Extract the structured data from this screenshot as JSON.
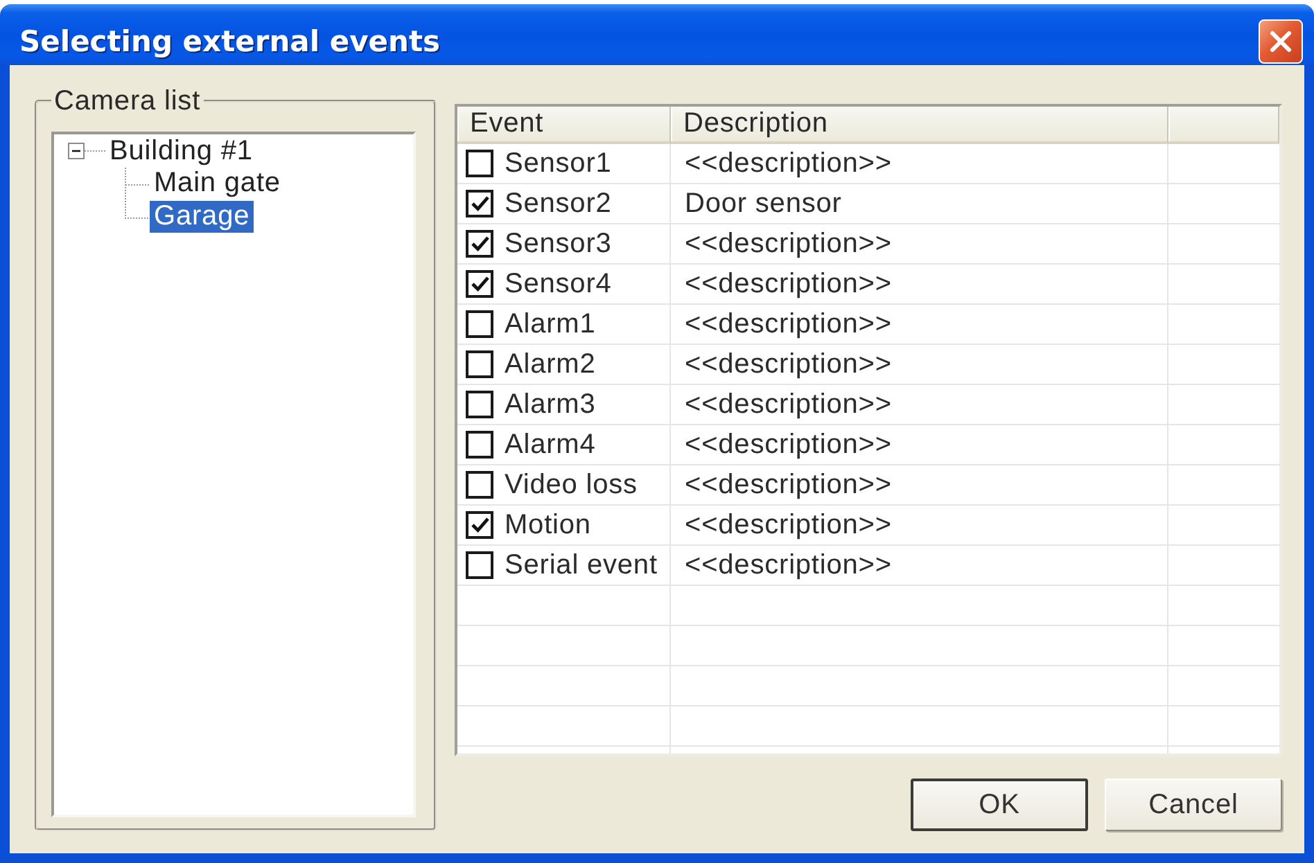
{
  "window": {
    "title": "Selecting external events"
  },
  "camera_list": {
    "title": "Camera list",
    "tree": [
      {
        "label": "Building #1",
        "expanded": true,
        "selected": false,
        "children": [
          {
            "label": "Main gate",
            "selected": false
          },
          {
            "label": "Garage",
            "selected": true
          }
        ]
      }
    ]
  },
  "event_table": {
    "columns": [
      "Event",
      "Description"
    ],
    "rows": [
      {
        "event": "Sensor1",
        "checked": false,
        "description": "<<description>>"
      },
      {
        "event": "Sensor2",
        "checked": true,
        "description": "Door sensor"
      },
      {
        "event": "Sensor3",
        "checked": true,
        "description": "<<description>>"
      },
      {
        "event": "Sensor4",
        "checked": true,
        "description": "<<description>>"
      },
      {
        "event": "Alarm1",
        "checked": false,
        "description": "<<description>>"
      },
      {
        "event": "Alarm2",
        "checked": false,
        "description": "<<description>>"
      },
      {
        "event": "Alarm3",
        "checked": false,
        "description": "<<description>>"
      },
      {
        "event": "Alarm4",
        "checked": false,
        "description": "<<description>>"
      },
      {
        "event": "Video loss",
        "checked": false,
        "description": "<<description>>"
      },
      {
        "event": "Motion",
        "checked": true,
        "description": "<<description>>"
      },
      {
        "event": "Serial event",
        "checked": false,
        "description": "<<description>>"
      }
    ]
  },
  "buttons": [
    {
      "label": "OK",
      "default": true
    },
    {
      "label": "Cancel",
      "default": false
    }
  ]
}
